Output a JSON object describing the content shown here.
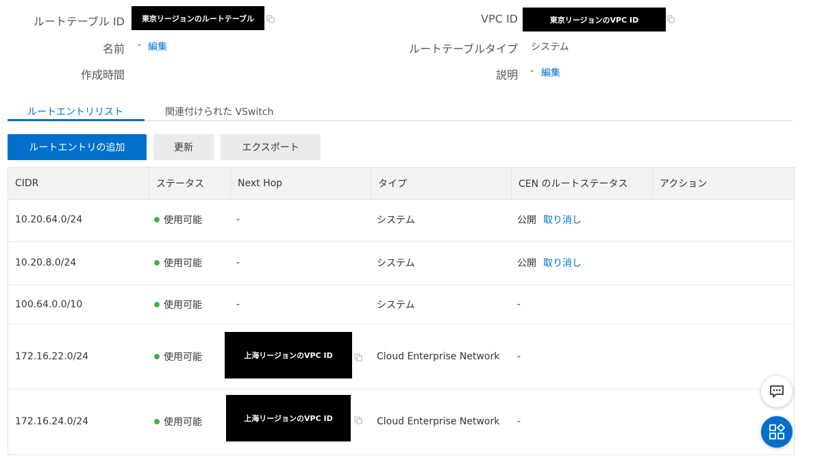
{
  "details": {
    "route_table_id_label": "ルートテーブル ID",
    "route_table_id_value": "東京リージョンのルートテーブル",
    "name_label": "名前",
    "name_value": "-",
    "name_edit": "編集",
    "created_label": "作成時間",
    "vpc_id_label": "VPC ID",
    "vpc_id_value": "東京リージョンのVPC ID",
    "type_label": "ルートテーブルタイプ",
    "type_value": "システム",
    "desc_label": "説明",
    "desc_value": "-",
    "desc_edit": "編集"
  },
  "tabs": [
    {
      "label": "ルートエントリリスト",
      "active": true
    },
    {
      "label": "関連付けられた VSwitch",
      "active": false
    }
  ],
  "toolbar": {
    "add_label": "ルートエントリの追加",
    "refresh_label": "更新",
    "export_label": "エクスポート"
  },
  "table": {
    "headers": [
      "CIDR",
      "ステータス",
      "Next Hop",
      "タイプ",
      "CEN のルートステータス",
      "アクション"
    ],
    "rows": [
      {
        "cidr": "10.20.64.0/24",
        "status": "使用可能",
        "next_hop": "-",
        "type": "システム",
        "cen_status": "公開",
        "cen_action": "取り消し"
      },
      {
        "cidr": "10.20.8.0/24",
        "status": "使用可能",
        "next_hop": "-",
        "type": "システム",
        "cen_status": "公開",
        "cen_action": "取り消し"
      },
      {
        "cidr": "100.64.0.0/10",
        "status": "使用可能",
        "next_hop": "-",
        "type": "システム",
        "cen_status": "-",
        "cen_action": ""
      },
      {
        "cidr": "172.16.22.0/24",
        "status": "使用可能",
        "next_hop": "上海リージョンのVPC ID",
        "type": "Cloud Enterprise Network",
        "cen_status": "-",
        "cen_action": ""
      },
      {
        "cidr": "172.16.24.0/24",
        "status": "使用可能",
        "next_hop": "上海リージョンのVPC ID",
        "type": "Cloud Enterprise Network",
        "cen_status": "-",
        "cen_action": ""
      }
    ]
  },
  "icons": {
    "copy": "copy-icon",
    "chat": "chat-icon",
    "apps": "apps-icon"
  },
  "colors": {
    "accent": "#0070cc",
    "status_ok": "#3cb44b",
    "redaction": "#000000"
  }
}
